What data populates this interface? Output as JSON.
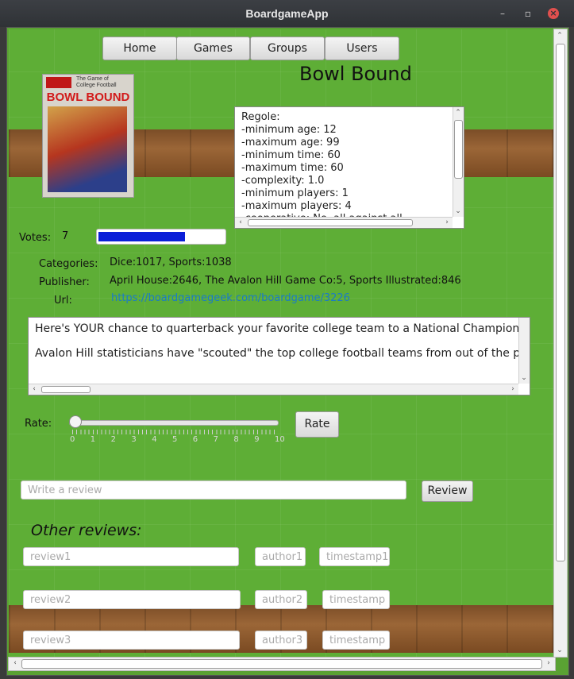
{
  "window": {
    "title": "BoardgameApp"
  },
  "nav": {
    "home": "Home",
    "games": "Games",
    "groups": "Groups",
    "users": "Users"
  },
  "game": {
    "title": "Bowl Bound",
    "cover": {
      "header_caption": "The Game of College Football",
      "title": "BOWL BOUND"
    }
  },
  "rules": {
    "lines": "Regole:\n-minimum age: 12\n-maximum age: 99\n-minimum time: 60\n-maximum time: 60\n-complexity: 1.0\n-minimum players: 1\n-maximum players: 4\n-cooperative: No, all against all"
  },
  "votes": {
    "label": "Votes:",
    "count": "7",
    "progress": 0.7
  },
  "info": {
    "categories_label": "Categories:",
    "categories": "Dice:1017, Sports:1038",
    "publisher_label": "Publisher:",
    "publisher": "April House:2646, The Avalon Hill Game Co:5, Sports Illustrated:846",
    "url_label": "Url:",
    "url": "https://boardgamegeek.com/boardgame/3226"
  },
  "description": {
    "p1": "Here's YOUR chance to quarterback your favorite college team to a National Championship!",
    "p2": "Avalon Hill statisticians have \"scouted\" the top college football teams from out of the past. Th"
  },
  "rate": {
    "label": "Rate:",
    "button": "Rate",
    "ticks": [
      "0",
      "1",
      "2",
      "3",
      "4",
      "5",
      "6",
      "7",
      "8",
      "9",
      "10"
    ],
    "value": 0
  },
  "review": {
    "placeholder": "Write a review",
    "button": "Review"
  },
  "other_reviews": {
    "heading": "Other reviews:",
    "items": [
      {
        "review": "review1",
        "author": "author1",
        "timestamp": "timestamp1"
      },
      {
        "review": "review2",
        "author": "author2",
        "timestamp": "timestamp"
      },
      {
        "review": "review3",
        "author": "author3",
        "timestamp": "timestamp"
      }
    ]
  }
}
